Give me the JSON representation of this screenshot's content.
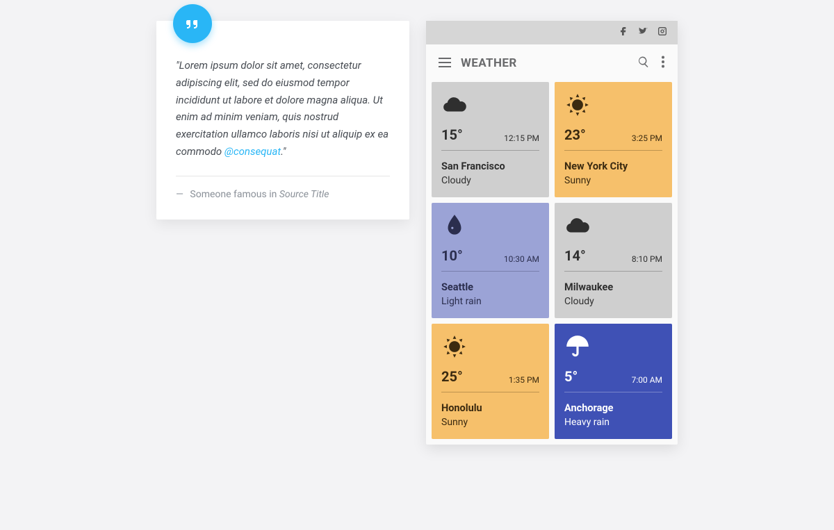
{
  "quote": {
    "body_pre": "\"Lorem ipsum dolor sit amet, consectetur adipiscing elit, sed do eiusmod tempor incididunt ut labore et dolore magna aliqua. Ut enim ad minim veniam, quis nostrud exercitation ullamco laboris nisi ut aliquip ex ea commodo ",
    "link_text": "@consequat",
    "body_post": ".\"",
    "footer_prefix": "Someone famous in ",
    "source_title": "Source Title"
  },
  "weather": {
    "title": "WEATHER",
    "social": [
      "facebook",
      "twitter",
      "instagram"
    ],
    "cards": [
      {
        "city": "San Francisco",
        "cond": "Cloudy",
        "temp": "15°",
        "time": "12:15 PM",
        "variant": "gray",
        "icon": "cloud"
      },
      {
        "city": "New York City",
        "cond": "Sunny",
        "temp": "23°",
        "time": "3:25 PM",
        "variant": "orange",
        "icon": "sun"
      },
      {
        "city": "Seattle",
        "cond": "Light rain",
        "temp": "10°",
        "time": "10:30 AM",
        "variant": "lilac",
        "icon": "drop"
      },
      {
        "city": "Milwaukee",
        "cond": "Cloudy",
        "temp": "14°",
        "time": "8:10 PM",
        "variant": "gray",
        "icon": "cloud"
      },
      {
        "city": "Honolulu",
        "cond": "Sunny",
        "temp": "25°",
        "time": "1:35 PM",
        "variant": "orange",
        "icon": "sun"
      },
      {
        "city": "Anchorage",
        "cond": "Heavy rain",
        "temp": "5°",
        "time": "7:00 AM",
        "variant": "blue",
        "icon": "umbrella"
      }
    ]
  }
}
